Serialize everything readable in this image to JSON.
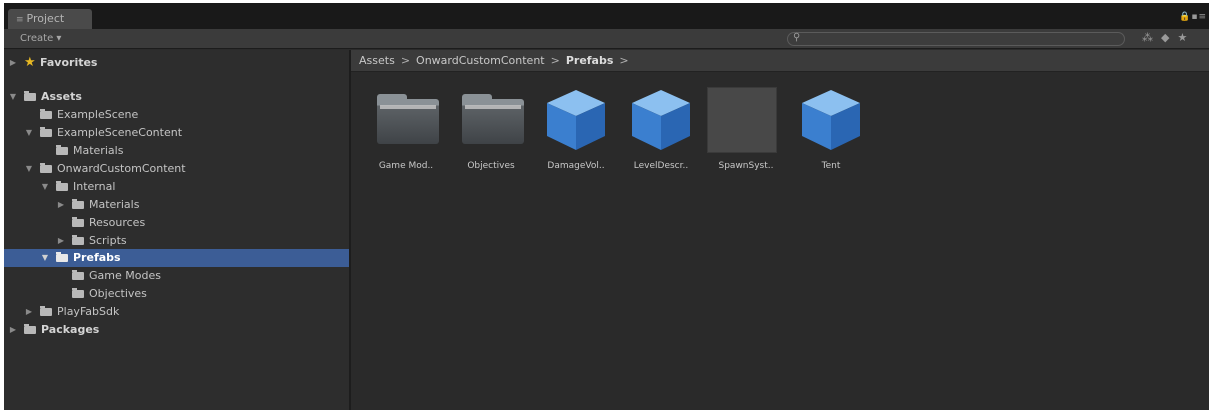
{
  "window": {
    "tab_title": "Project",
    "tab_icon": "folder-tab-icon"
  },
  "toolbar": {
    "create_label": "Create ▾",
    "search_placeholder": ""
  },
  "tree": {
    "favorites": "Favorites",
    "assets": "Assets",
    "example_scene": "ExampleScene",
    "example_scene_content": "ExampleSceneContent",
    "materials_1": "Materials",
    "onward_custom_content": "OnwardCustomContent",
    "internal": "Internal",
    "materials_2": "Materials",
    "resources": "Resources",
    "scripts": "Scripts",
    "prefabs": "Prefabs",
    "game_modes": "Game Modes",
    "objectives": "Objectives",
    "playfab_sdk": "PlayFabSdk",
    "packages": "Packages"
  },
  "breadcrumb": {
    "part1": "Assets",
    "sep": ">",
    "part2": "OnwardCustomContent",
    "part3": "Prefabs"
  },
  "assets": [
    {
      "label": "Game Mod..",
      "kind": "folder"
    },
    {
      "label": "Objectives",
      "kind": "folder"
    },
    {
      "label": "DamageVol..",
      "kind": "prefab"
    },
    {
      "label": "LevelDescr..",
      "kind": "prefab"
    },
    {
      "label": "SpawnSyst..",
      "kind": "empty"
    },
    {
      "label": "Tent",
      "kind": "prefab"
    }
  ],
  "colors": {
    "selection": "#3c5d96",
    "cube": "#4a90d9",
    "star": "#e8b923"
  }
}
